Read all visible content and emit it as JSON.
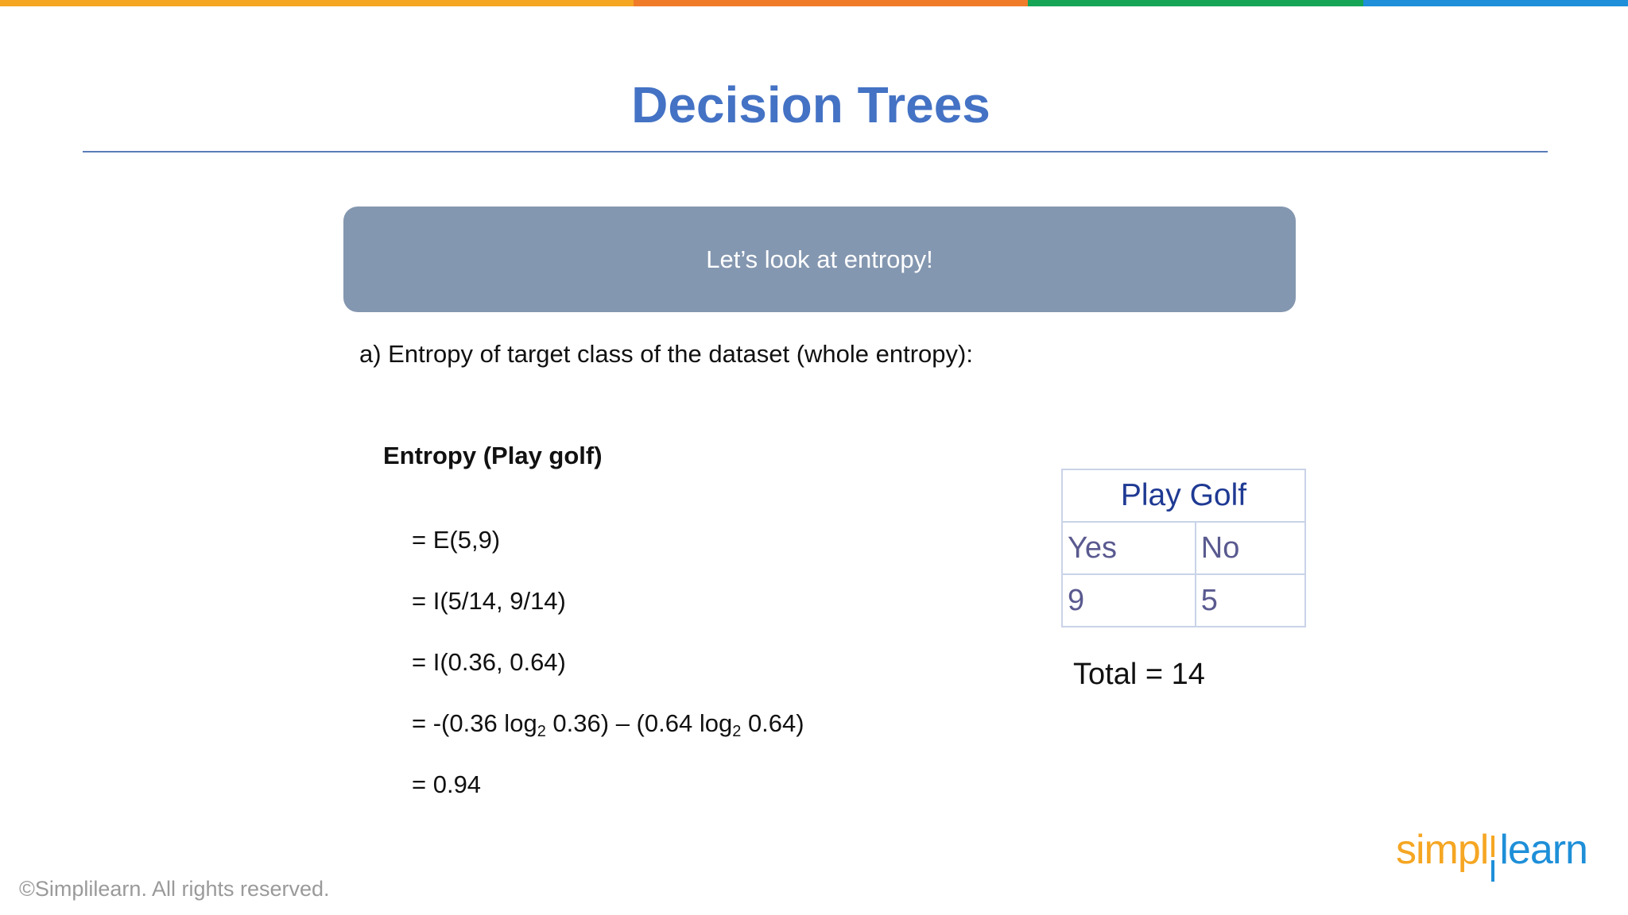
{
  "colors": {
    "top_bar": [
      "#F5A623",
      "#F07C2A",
      "#16A556",
      "#1E8FD8"
    ],
    "title": "#4472C4",
    "banner": "#8497B0",
    "table_header": "#1F3A93",
    "table_cells": "#5A5A90",
    "logo_orange": "#F5A623",
    "logo_blue": "#1E8FD8"
  },
  "slide": {
    "title": "Decision Trees",
    "banner": "Let’s look at entropy!",
    "intro": "a) Entropy of target class of the dataset (whole entropy):",
    "entropy_heading": "Entropy (Play golf)",
    "formula": {
      "line1": "= E(5,9)",
      "line2": "= I(5/14, 9/14)",
      "line3": "= I(0.36, 0.64)",
      "line4_a": "= -(0.36 log",
      "line4_sub1": "2",
      "line4_b": " 0.36) – (0.64 log",
      "line4_sub2": "2",
      "line4_c": " 0.64)",
      "line5": "= 0.94"
    }
  },
  "table": {
    "header": "Play Golf",
    "columns": [
      "Yes",
      "No"
    ],
    "values": [
      "9",
      "5"
    ]
  },
  "total": "Total = 14",
  "footer": {
    "copyright": "©Simplilearn. All rights reserved.",
    "logo_part_a": "simpl",
    "logo_part_b": "learn"
  }
}
